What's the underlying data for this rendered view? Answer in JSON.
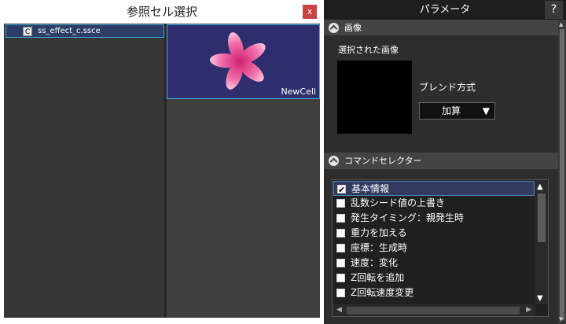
{
  "dialog": {
    "title": "参照セル選択",
    "close_label": "x",
    "cell_list": [
      {
        "badge": "C",
        "name": "ss_effect_c.ssce"
      }
    ],
    "preview": {
      "cell_name": "NewCell"
    }
  },
  "panel": {
    "title": "パラメータ",
    "help_label": "?",
    "image_section": {
      "header": "画像",
      "selected_label": "選択された画像",
      "blend_label": "ブレンド方式",
      "blend_value": "加算",
      "blend_arrow": "▼"
    },
    "command_section": {
      "header": "コマンドセレクター",
      "items": [
        {
          "label": "基本情報",
          "checked": true,
          "selected": true
        },
        {
          "label": "乱数シード値の上書き",
          "checked": false
        },
        {
          "label": "発生タイミング：親発生時",
          "checked": false
        },
        {
          "label": "重力を加える",
          "checked": false
        },
        {
          "label": "座標：生成時",
          "checked": false
        },
        {
          "label": "速度：変化",
          "checked": false
        },
        {
          "label": "Z回転を追加",
          "checked": false
        },
        {
          "label": "Z回転速度変更",
          "checked": false
        }
      ]
    }
  },
  "colors": {
    "accent_blue": "#3fa6d6",
    "flower_pink": "#e8508f",
    "preview_bg": "#2e2e6e"
  }
}
